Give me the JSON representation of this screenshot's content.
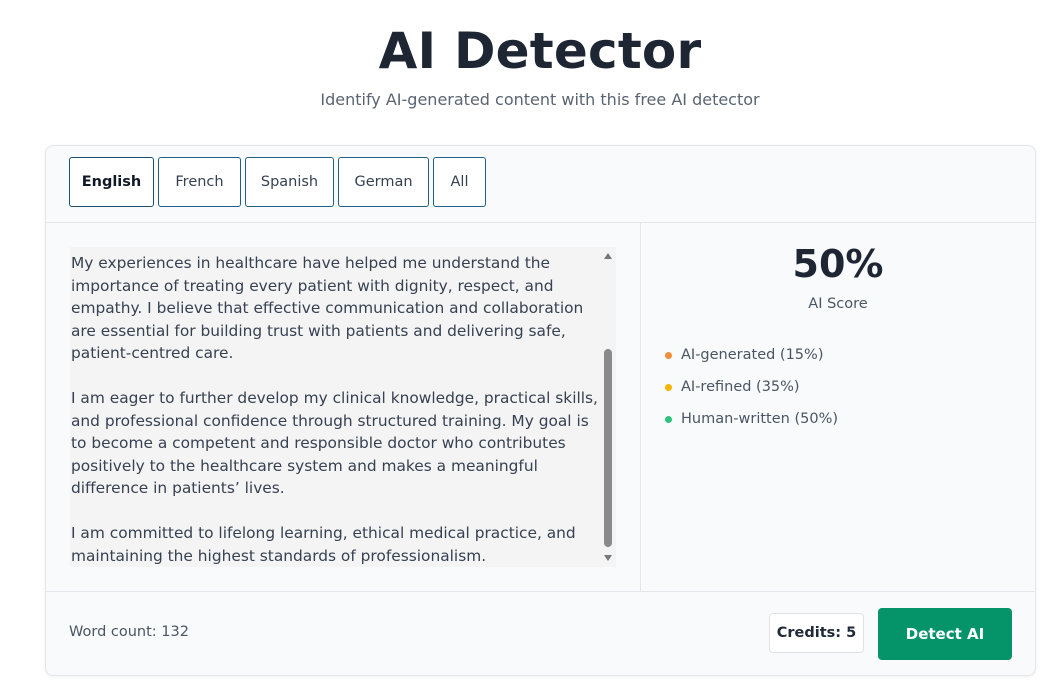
{
  "header": {
    "title": "AI Detector",
    "subtitle": "Identify AI-generated content with this free AI detector"
  },
  "tabs": [
    {
      "label": "English",
      "active": true
    },
    {
      "label": "French",
      "active": false
    },
    {
      "label": "Spanish",
      "active": false
    },
    {
      "label": "German",
      "active": false
    },
    {
      "label": "All",
      "active": false
    }
  ],
  "input_text": {
    "paragraphs": [
      "My experiences in healthcare have helped me understand the importance of treating every patient with dignity, respect, and empathy. I believe that effective communication and collaboration are essential for building trust with patients and delivering safe, patient-centred care.",
      "I am eager to further develop my clinical knowledge, practical skills, and professional confidence through structured training. My goal is to become a competent and responsible doctor who contributes positively to the healthcare system and makes a meaningful difference in patients’ lives.",
      "I am committed to lifelong learning, ethical medical practice, and maintaining the highest standards of professionalism."
    ]
  },
  "results": {
    "score": "50%",
    "score_label": "AI Score",
    "legend": [
      {
        "label": "AI-generated (15%)",
        "color": "#f08c3a"
      },
      {
        "label": "AI-refined (35%)",
        "color": "#f4b400"
      },
      {
        "label": "Human-written (50%)",
        "color": "#2ec27e"
      }
    ]
  },
  "footer": {
    "word_count": "Word count: 132",
    "credits": "Credits: 5",
    "detect_label": "Detect AI"
  },
  "colors": {
    "accent": "#05946a",
    "tab_border": "#1f5e88"
  }
}
